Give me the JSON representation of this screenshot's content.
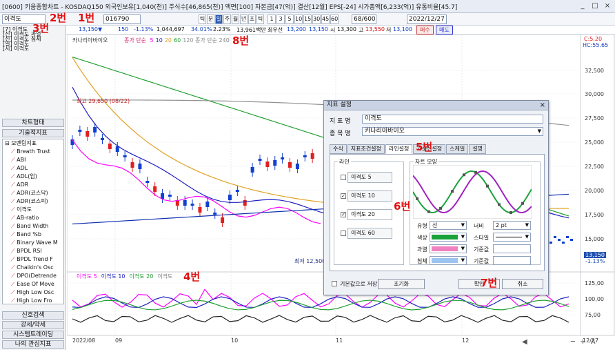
{
  "title_bar": {
    "text": "[0600] 키움종합차트 - KOSDAQ150 외국인보유[1,040(천)] 주식수[46,865(천)] 액면[100] 자본금[47(억)] 결산[12월] EPS[-24] 시가총액[6,233(억)] 유통비율[45.7]",
    "btn_minimize": "_",
    "btn_restore": "□",
    "btn_close": "×"
  },
  "toolbar": {
    "indicator_select": "이격도",
    "code_input": "016790",
    "period_buttons": [
      "틱",
      "분",
      "일",
      "주",
      "월",
      "년",
      "초",
      "틱"
    ],
    "num_buttons": [
      "1",
      "3",
      "5",
      "10",
      "15",
      "30",
      "45",
      "60"
    ],
    "count_field": "68/600",
    "date_field": "2022/12/27"
  },
  "quote_row": {
    "price": "13,150▼",
    "change": "150",
    "change_pct": "-1.13%",
    "volume": "1,044,697",
    "turnover_pct": "34.01%",
    "vol_ratio": "2.23%",
    "amount": "13,961백만",
    "info1": "최우선",
    "info2": "13,200",
    "info3": "13,150",
    "open_label": "시",
    "open_value": "13,300",
    "high_label": "고",
    "high_value": "13,550",
    "low_label": "저",
    "low_value": "13,100",
    "buy_label": "매수",
    "sell_label": "매도"
  },
  "sidebar": {
    "favorites": [
      "[7] 이격도",
      "[신] 이격도 과열",
      "[신] 이격도 침체",
      "[일] 이격도",
      "[시] 이격도"
    ],
    "chart_type_btn": "차트형태",
    "tech_btn": "기술적지표",
    "tree_root": "모멘텀지표",
    "tree_items": [
      "Breath Trust",
      "ABI",
      "ADL",
      "ADL(업)",
      "ADR",
      "ADR(코스닥)",
      "ADR(코스피)",
      "이격도",
      "AB-ratio",
      "Band Width",
      "Band %b",
      "Binary Wave M",
      "BPDL RSI",
      "BPDL Trend F",
      "Chaikin's Osc",
      "DPO(Detrende",
      "Ease Of Move",
      "High Low Osc",
      "High Low Fro"
    ],
    "bottom_btns": [
      "신호검색",
      "강세/약세",
      "시스템트레이딩",
      "나의 관심지표"
    ]
  },
  "chart": {
    "stock_name": "카나리아바이오",
    "ma_legend_prefix": "종가 단순",
    "ma_periods": [
      "5",
      "10",
      "20",
      "60",
      "120"
    ],
    "ma_colors": [
      "#ff00ff",
      "#2020c0",
      "#e0a020",
      "#20a030",
      "#909090"
    ],
    "ma240_label": "종가 단순 240",
    "high_annotation": "최고 29,650 (08/22)",
    "low_annotation": "최저 12,500",
    "price_axis": [
      "32,500",
      "30,000",
      "27,500",
      "25,000",
      "22,500",
      "20,000",
      "17,500",
      "15,000"
    ],
    "last_price_tag": "13,150",
    "last_pct_tag": "-1.13%",
    "top_right_tags": [
      "C:5.20",
      "HC:55.65"
    ],
    "osc_legend": [
      "이격도 5",
      "이격도 10",
      "이격도 20",
      "이격도"
    ],
    "osc_colors": [
      "#ff00ff",
      "#2020c0",
      "#20a030",
      "#808080"
    ],
    "osc_axis": [
      "125,00",
      "100,00",
      "75,00"
    ],
    "date_axis": [
      "2022/08",
      "09",
      "10",
      "11",
      "12",
      "12/27"
    ],
    "zoom_icons": [
      "◀",
      "─",
      "+",
      "A"
    ]
  },
  "dialog": {
    "title": "지표 설정",
    "close": "×",
    "indicator_label": "지 표 명",
    "indicator_value": "이격도",
    "stock_label": "종 목 명",
    "stock_value": "카나리아바이오",
    "tabs": [
      "수식",
      "지표조건설정",
      "라인설정",
      "기준선설정",
      "스케일",
      "설명"
    ],
    "active_tab": "라인설정",
    "line_group_title": "라인",
    "lines": [
      {
        "label": "이격도 5",
        "checked": ""
      },
      {
        "label": "이격도 10",
        "checked": "✓"
      },
      {
        "label": "이격도 20",
        "checked": "✓"
      },
      {
        "label": "이격도 60",
        "checked": ""
      }
    ],
    "shape_group_title": "차트 모양",
    "type_label": "유형",
    "type_value": "선",
    "width_label": "너비",
    "width_value": "2 pt",
    "color_label": "색상",
    "color_value": "#1aa23a",
    "style_label": "스타일",
    "overheat_label": "과열",
    "overheat_color": "#f080c0",
    "std_label": "기준값",
    "oversold_label": "침체",
    "oversold_color": "#9cc4f0",
    "std_label2": "기준값",
    "save_default": "기본값으로 저장",
    "reset_btn": "초기화",
    "ok_btn": "확인",
    "cancel_btn": "취소"
  },
  "annotations": [
    "1번",
    "2번",
    "3번",
    "4번",
    "5번",
    "6번",
    "7번",
    "8번"
  ]
}
